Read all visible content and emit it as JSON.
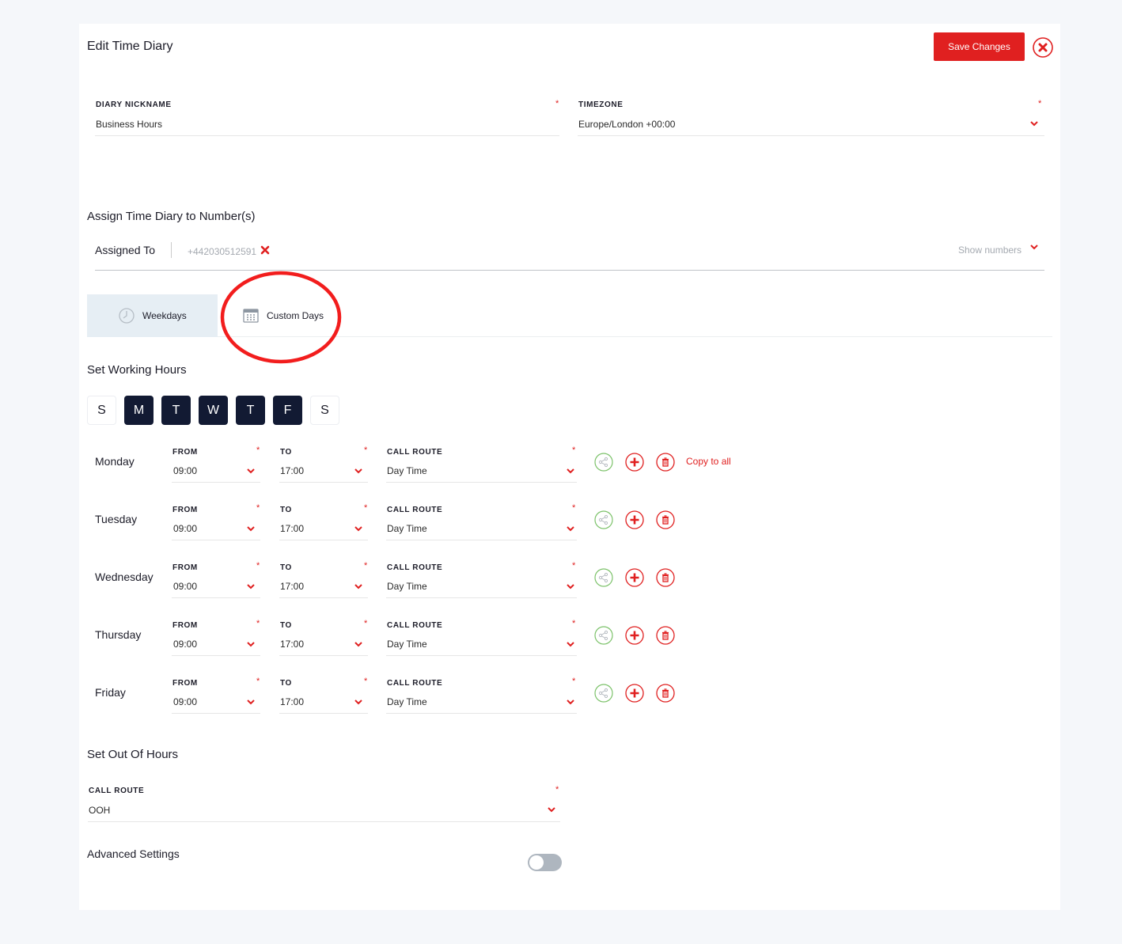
{
  "header": {
    "title": "Edit Time Diary",
    "save_label": "Save Changes"
  },
  "form": {
    "nickname": {
      "label": "DIARY NICKNAME",
      "value": "Business Hours"
    },
    "timezone": {
      "label": "TIMEZONE",
      "value": "Europe/London +00:00"
    }
  },
  "assign": {
    "section_title": "Assign Time Diary to Number(s)",
    "assigned_label": "Assigned To",
    "number": "+442030512591",
    "show_numbers": "Show numbers"
  },
  "tabs": [
    {
      "label": "Weekdays",
      "icon": "clock-icon",
      "active": true
    },
    {
      "label": "Custom Days",
      "icon": "calendar-icon",
      "active": false
    }
  ],
  "working_hours": {
    "section_title": "Set Working Hours",
    "day_toggles": [
      {
        "letter": "S",
        "active": false
      },
      {
        "letter": "M",
        "active": true
      },
      {
        "letter": "T",
        "active": true
      },
      {
        "letter": "W",
        "active": true
      },
      {
        "letter": "T",
        "active": true
      },
      {
        "letter": "F",
        "active": true
      },
      {
        "letter": "S",
        "active": false
      }
    ],
    "from_label": "FROM",
    "to_label": "TO",
    "route_label": "CALL ROUTE",
    "copy_all": "Copy to all",
    "rows": [
      {
        "day": "Monday",
        "from": "09:00",
        "to": "17:00",
        "route": "Day Time"
      },
      {
        "day": "Tuesday",
        "from": "09:00",
        "to": "17:00",
        "route": "Day Time"
      },
      {
        "day": "Wednesday",
        "from": "09:00",
        "to": "17:00",
        "route": "Day Time"
      },
      {
        "day": "Thursday",
        "from": "09:00",
        "to": "17:00",
        "route": "Day Time"
      },
      {
        "day": "Friday",
        "from": "09:00",
        "to": "17:00",
        "route": "Day Time"
      }
    ]
  },
  "out_of_hours": {
    "section_title": "Set Out Of Hours",
    "route_label": "CALL ROUTE",
    "route_value": "OOH"
  },
  "advanced": {
    "label": "Advanced Settings",
    "enabled": false
  },
  "colors": {
    "accent": "#e02020",
    "dark": "#121a33",
    "share_green": "#7cc26a",
    "tab_active_bg": "#e6eef4"
  }
}
